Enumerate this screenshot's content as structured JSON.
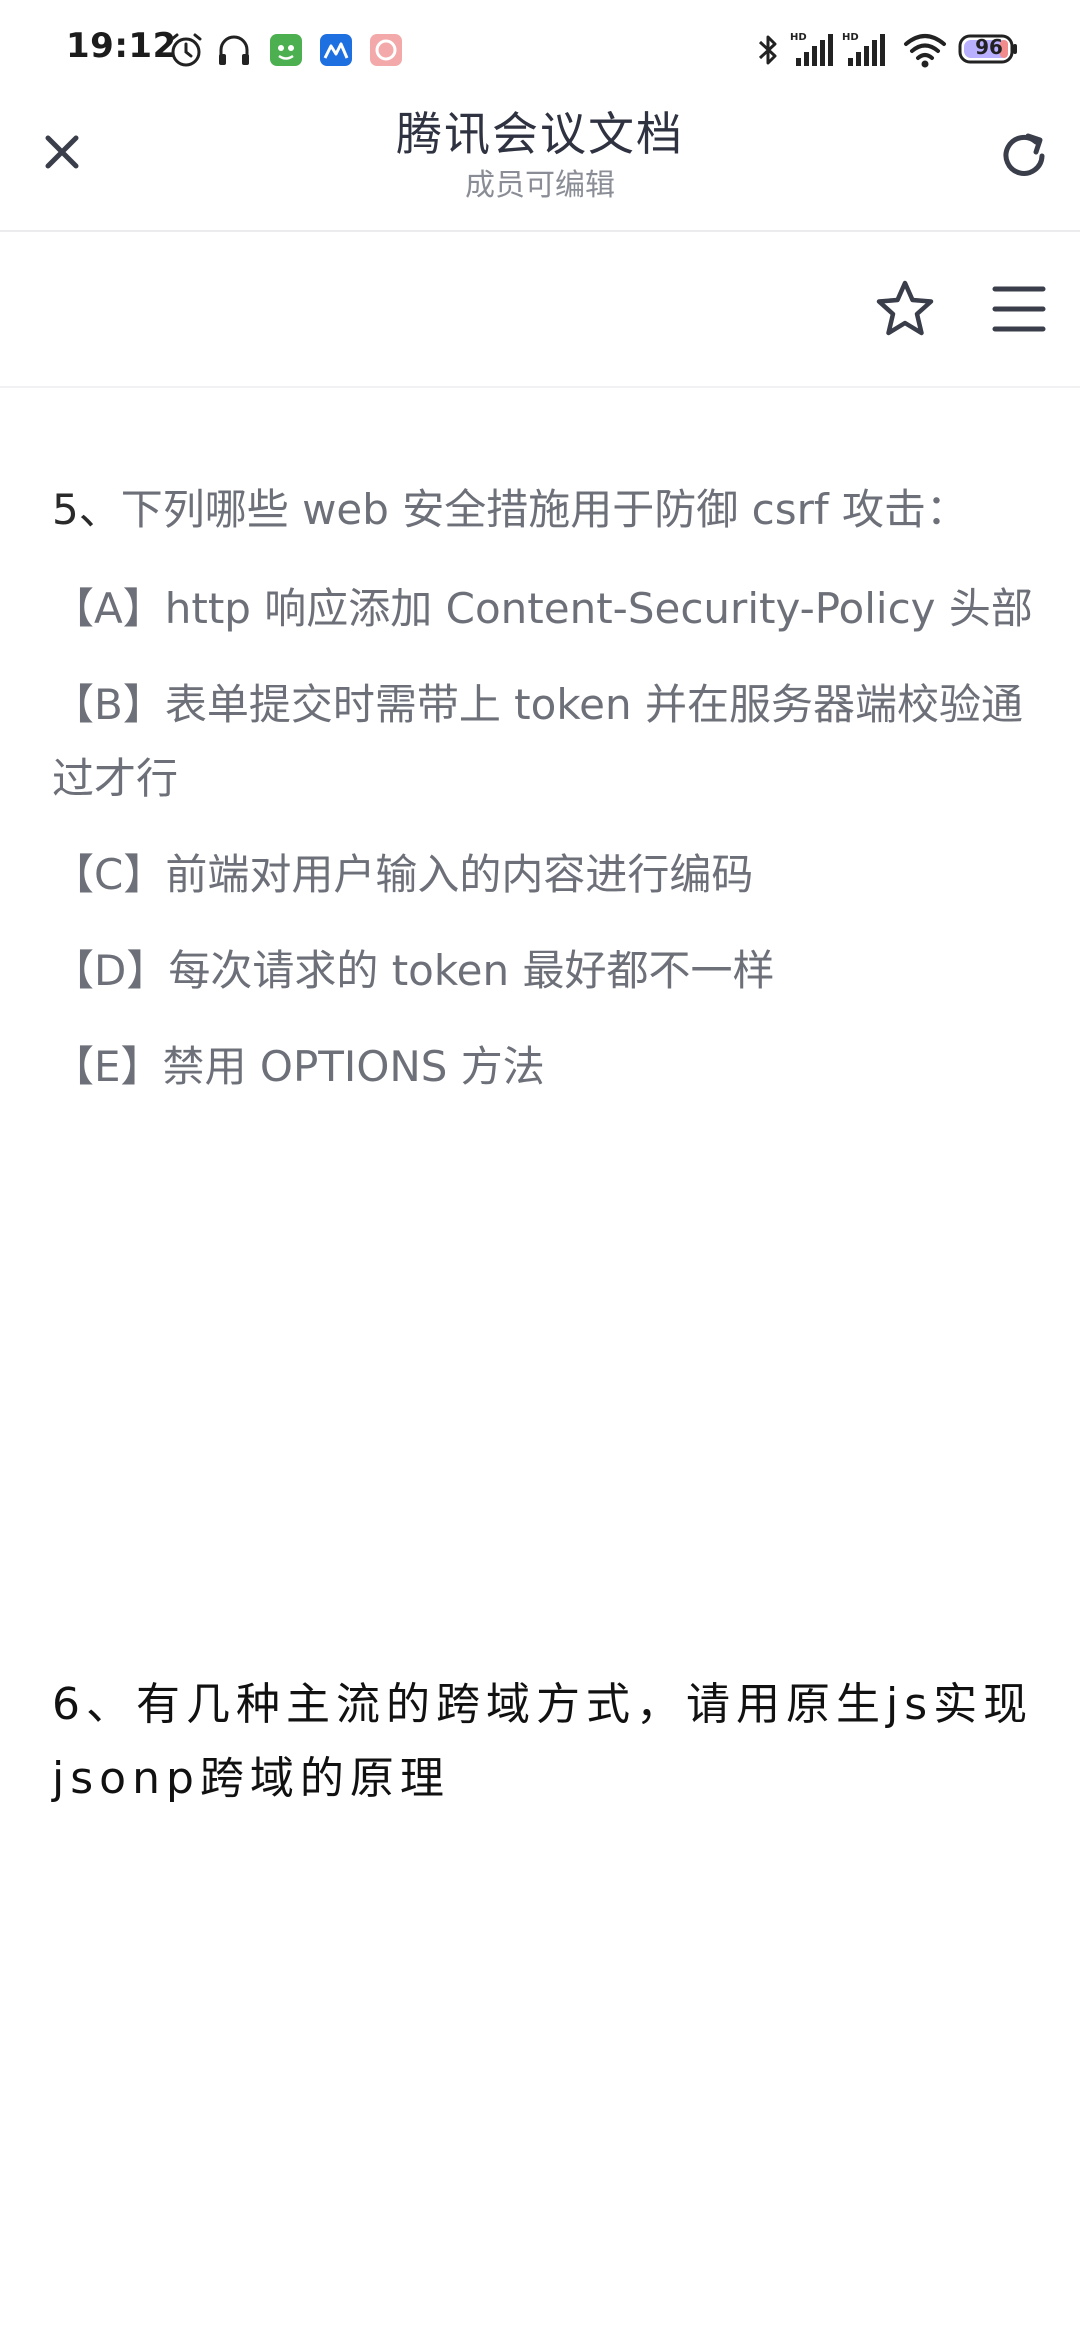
{
  "status_bar": {
    "time": "19:12",
    "battery_level": "96",
    "icons": [
      "alarm-icon",
      "headphones-icon",
      "app-green-icon",
      "app-blue-icon",
      "app-pink-icon",
      "bluetooth-icon",
      "signal-hd-icon",
      "signal-hd-icon",
      "wifi-icon",
      "battery-icon"
    ]
  },
  "header": {
    "title": "腾讯会议文档",
    "subtitle": "成员可编辑"
  },
  "toolbar": {
    "star": "star-icon",
    "menu": "menu-icon"
  },
  "document": {
    "q5": {
      "number": "5、",
      "text": "下列哪些 web 安全措施用于防御 csrf 攻击："
    },
    "options": [
      "【A】http 响应添加 Content-Security-Policy 头部",
      "【B】表单提交时需带上 token 并在服务器端校验通过才行",
      "【C】前端对用户输入的内容进行编码",
      "【D】每次请求的 token 最好都不一样",
      "【E】禁用 OPTIONS 方法"
    ],
    "q6": "6、有几种主流的跨域方式，请用原生js实现jsonp跨域的原理"
  },
  "colors": {
    "accent_text": "#2f3240",
    "muted_text": "#8a8d96",
    "option_text": "#6d7079",
    "battery_fill": "#b9b0ff"
  }
}
